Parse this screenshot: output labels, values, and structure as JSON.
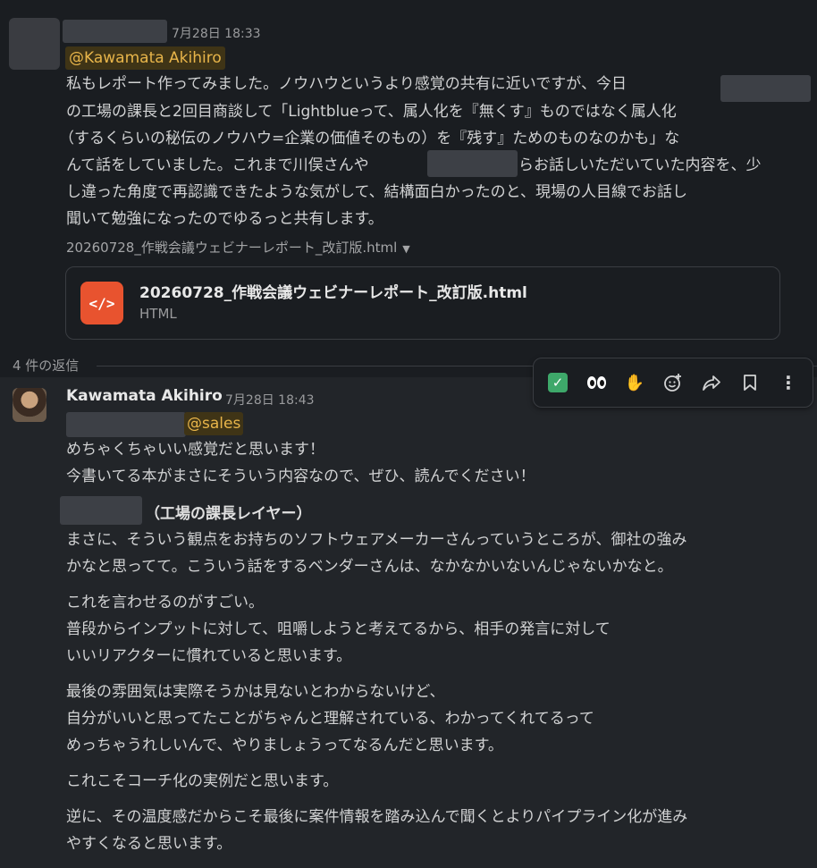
{
  "message1": {
    "timestamp": "7月28日 18:33",
    "mention": "@Kawamata Akihiro",
    "lines": [
      "私もレポート作ってみました。ノウハウというより感覚の共有に近いですが、今日",
      "の工場の課長と2回目商談して「Lightblueって、属人化を『無くす』ものではなく属人化",
      "（するくらいの秘伝のノウハウ=企業の価値そのもの）を『残す』ためのものなのかも」な",
      "んて話をしていました。これまで川俣さんや",
      "らお話しいただいていた内容を、少",
      "し違った角度で再認識できたような気がして、結構面白かったのと、現場の人目線でお話し",
      "聞いて勉強になったのでゆるっと共有します。"
    ],
    "file_label": "20260728_作戦会議ウェビナーレポート_改訂版.html",
    "file_name": "20260728_作戦会議ウェビナーレポート_改訂版.html",
    "file_type": "HTML"
  },
  "replies_label": "4 件の返信",
  "toolbar": {
    "icons": [
      "check-mark-icon",
      "eyes-icon",
      "raised-hands-icon",
      "add-reaction-icon",
      "share-icon",
      "bookmark-icon",
      "more-actions-icon"
    ]
  },
  "message2": {
    "author": "Kawamata Akihiro",
    "timestamp": "7月28日 18:43",
    "mention": "@sales",
    "lines_a": [
      "めちゃくちゃいい感覚だと思います！",
      "今書いてる本がまさにそういう内容なので、ぜひ、読んでください！"
    ],
    "heading": "（工場の課長レイヤー）",
    "lines_b": [
      "まさに、そういう観点をお持ちのソフトウェアメーカーさんっていうところが、御社の強み",
      "かなと思ってて。こういう話をするベンダーさんは、なかなかいないんじゃないかなと。"
    ],
    "lines_c": [
      "これを言わせるのがすごい。",
      "普段からインプットに対して、咀嚼しようと考えてるから、相手の発言に対して",
      "いいリアクターに慣れていると思います。"
    ],
    "lines_d": [
      "最後の雰囲気は実際そうかは見ないとわからないけど、",
      "自分がいいと思ってたことがちゃんと理解されている、わかってくれてるって",
      "めっちゃうれしいんで、やりましょうってなるんだと思います。"
    ],
    "lines_e": [
      "これこそコーチ化の実例だと思います。"
    ],
    "lines_f": [
      "逆に、その温度感だからこそ最後に案件情報を踏み込んで聞くとよりパイプライン化が進み",
      "やすくなると思います。"
    ]
  }
}
